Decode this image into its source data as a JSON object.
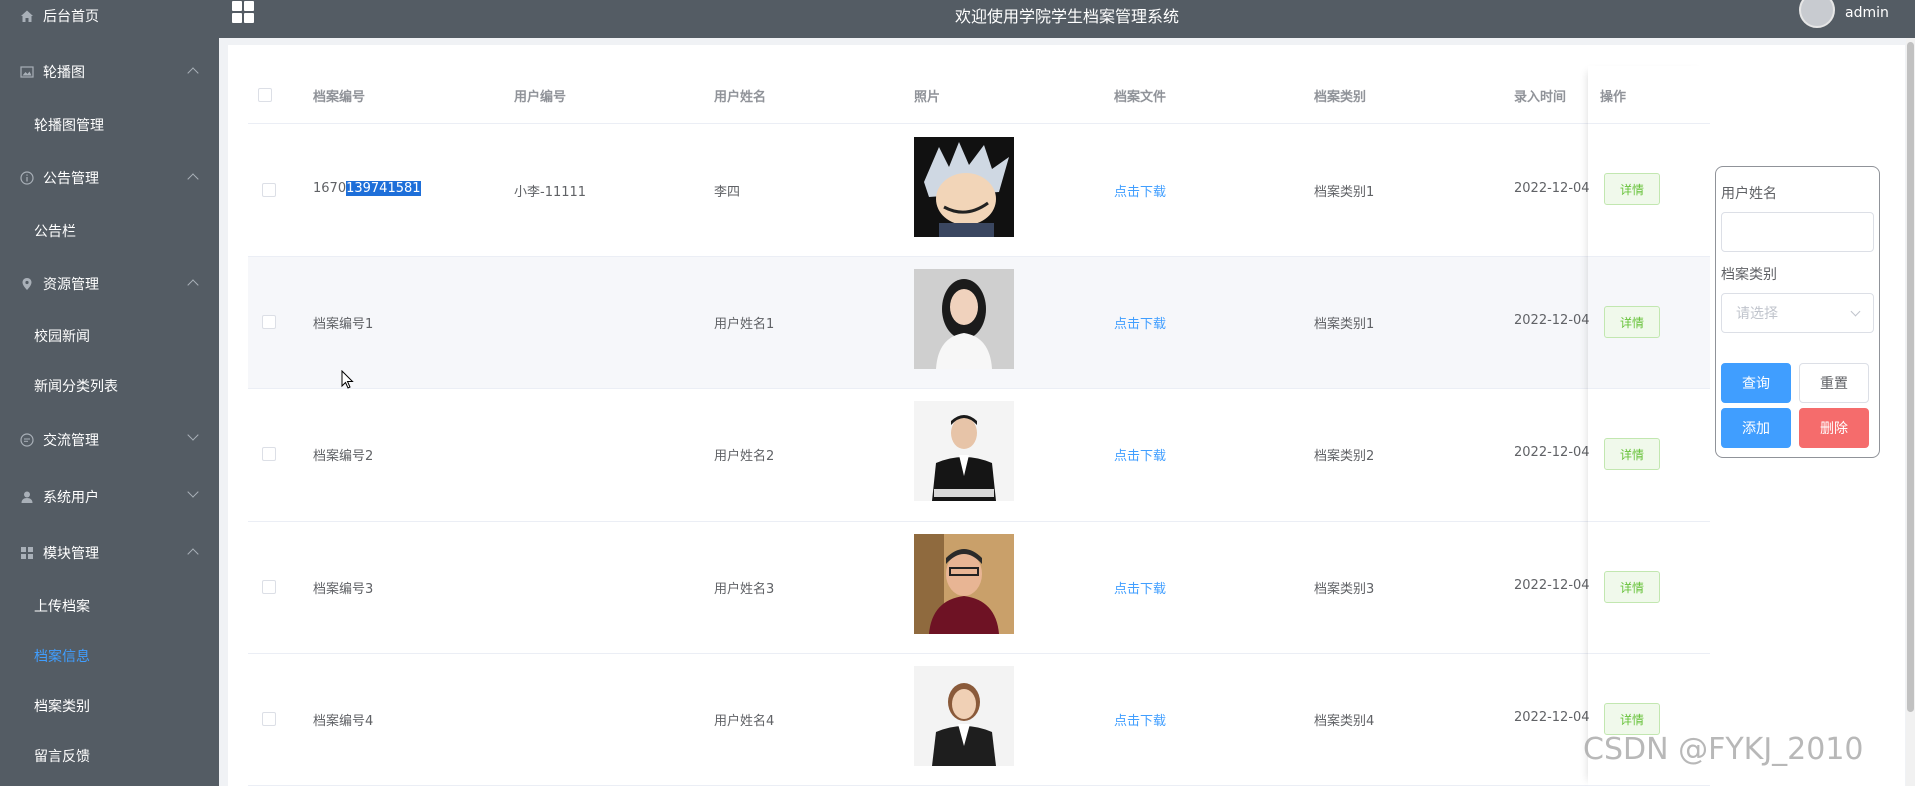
{
  "app": {
    "title": "欢迎使用学院学生档案管理系统",
    "user": "admin",
    "watermark": "CSDN @FYKJ_2010"
  },
  "sidebar": {
    "items": [
      {
        "label": "后台首页",
        "icon": "home-icon"
      },
      {
        "label": "轮播图",
        "icon": "image-icon",
        "expanded": true,
        "children": [
          "轮播图管理"
        ]
      },
      {
        "label": "公告管理",
        "icon": "info-icon",
        "expanded": true,
        "children": [
          "公告栏"
        ]
      },
      {
        "label": "资源管理",
        "icon": "location-icon",
        "expanded": true,
        "children": [
          "校园新闻",
          "新闻分类列表"
        ]
      },
      {
        "label": "交流管理",
        "icon": "chat-icon",
        "expanded": false
      },
      {
        "label": "系统用户",
        "icon": "user-icon",
        "expanded": false
      },
      {
        "label": "模块管理",
        "icon": "menu-icon",
        "expanded": true,
        "children": [
          "上传档案",
          "档案信息",
          "档案类别",
          "留言反馈"
        ]
      }
    ],
    "active": "档案信息"
  },
  "table": {
    "columns": [
      "档案编号",
      "用户编号",
      "用户姓名",
      "照片",
      "档案文件",
      "档案类别",
      "录入时间",
      "操作"
    ],
    "rows": [
      {
        "id_pre": "1670",
        "id_sel": "139741581",
        "user_no": "小李-11111",
        "name": "李四",
        "file": "点击下载",
        "category": "档案类别1",
        "time": "2022-12-04",
        "action": "详情"
      },
      {
        "id_pre": "档案编号1",
        "id_sel": "",
        "user_no": "",
        "name": "用户姓名1",
        "file": "点击下载",
        "category": "档案类别1",
        "time": "2022-12-04",
        "action": "详情"
      },
      {
        "id_pre": "档案编号2",
        "id_sel": "",
        "user_no": "",
        "name": "用户姓名2",
        "file": "点击下载",
        "category": "档案类别2",
        "time": "2022-12-04",
        "action": "详情"
      },
      {
        "id_pre": "档案编号3",
        "id_sel": "",
        "user_no": "",
        "name": "用户姓名3",
        "file": "点击下载",
        "category": "档案类别3",
        "time": "2022-12-04",
        "action": "详情"
      },
      {
        "id_pre": "档案编号4",
        "id_sel": "",
        "user_no": "",
        "name": "用户姓名4",
        "file": "点击下载",
        "category": "档案类别4",
        "time": "2022-12-04",
        "action": "详情"
      }
    ]
  },
  "search": {
    "name_label": "用户姓名",
    "name_value": "",
    "category_label": "档案类别",
    "category_placeholder": "请选择",
    "query": "查询",
    "reset": "重置",
    "add": "添加",
    "delete": "删除"
  }
}
